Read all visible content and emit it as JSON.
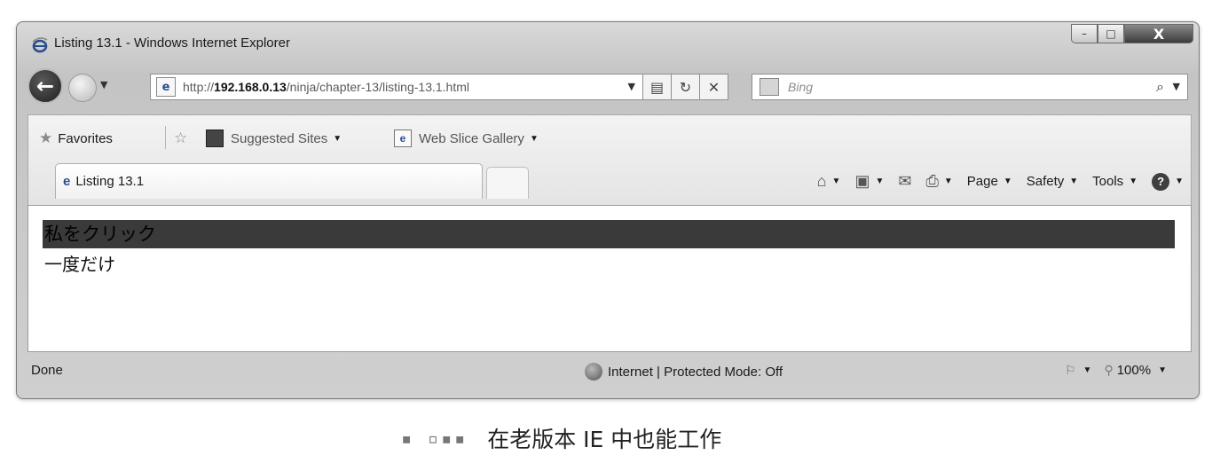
{
  "window": {
    "title": "Listing 13.1 - Windows Internet Explorer",
    "caption_min": "–",
    "caption_max": "□",
    "caption_close": "X"
  },
  "nav": {
    "back_glyph": "←",
    "url_prefix": "http://",
    "url_host": "192.168.0.13",
    "url_path": "/ninja/chapter-13/listing-13.1.html",
    "search_placeholder": "Bing",
    "search_glyph": "⌕"
  },
  "favorites_bar": {
    "favorites_label": "Favorites",
    "suggested_sites_label": "Suggested Sites",
    "web_slice_label": "Web Slice Gallery"
  },
  "tab": {
    "label": "Listing 13.1"
  },
  "command_bar": {
    "page_label": "Page",
    "safety_label": "Safety",
    "tools_label": "Tools",
    "help_glyph": "?"
  },
  "content": {
    "click_me_text": "私をクリック",
    "once_text": "一度だけ"
  },
  "statusbar": {
    "status_text": "Done",
    "zone_text": "Internet | Protected Mode: Off",
    "zoom_text": "100%"
  },
  "figure": {
    "number": "▪ ▫▪▪",
    "caption": "在老版本 IE 中也能工作"
  },
  "colors": {
    "accent_ie_blue": "#2a4d8f",
    "highlight_bar": "#3a3a3a"
  }
}
